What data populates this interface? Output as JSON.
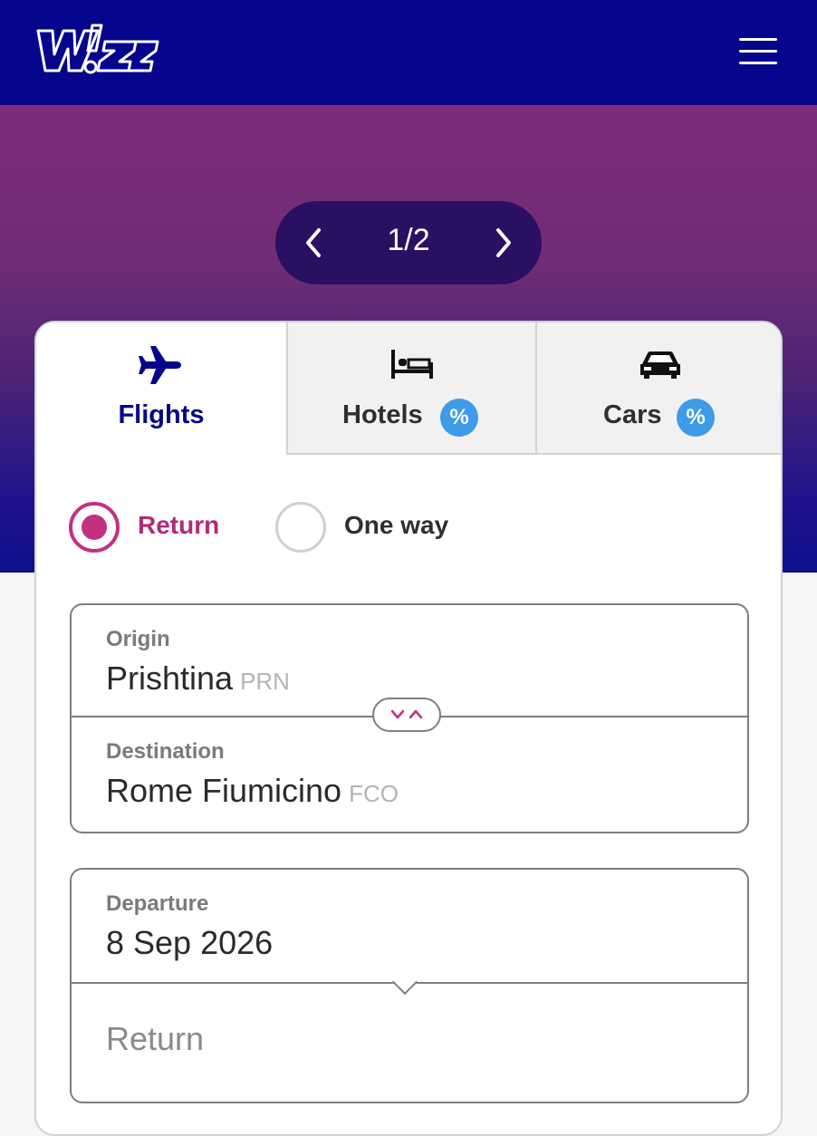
{
  "header": {
    "logo_text": "W!ZZ",
    "menu_icon": "hamburger-menu-icon",
    "background": "#06068c"
  },
  "hero": {
    "pager": {
      "current": "1/2",
      "prev_icon": "chevron-left-icon",
      "next_icon": "chevron-right-icon"
    }
  },
  "tabs": [
    {
      "label": "Flights",
      "icon": "airplane-icon",
      "active": true
    },
    {
      "label": "Hotels",
      "icon": "bed-icon",
      "badge": "%"
    },
    {
      "label": "Cars",
      "icon": "car-icon",
      "badge": "%"
    }
  ],
  "trip_type": {
    "return_label": "Return",
    "oneway_label": "One way",
    "selected": "Return"
  },
  "route": {
    "origin": {
      "label": "Origin",
      "city": "Prishtina",
      "code": "PRN"
    },
    "destination": {
      "label": "Destination",
      "city": "Rome Fiumicino",
      "code": "FCO"
    },
    "swap_icon": "swap-arrows-icon"
  },
  "dates": {
    "departure": {
      "label": "Departure",
      "value": "8 Sep 2026"
    },
    "return": {
      "placeholder": "Return"
    }
  },
  "colors": {
    "brand_navy": "#06068c",
    "accent_magenta": "#c2307f",
    "badge_blue": "#3d9be8",
    "pager_bg": "#2a0f63"
  }
}
